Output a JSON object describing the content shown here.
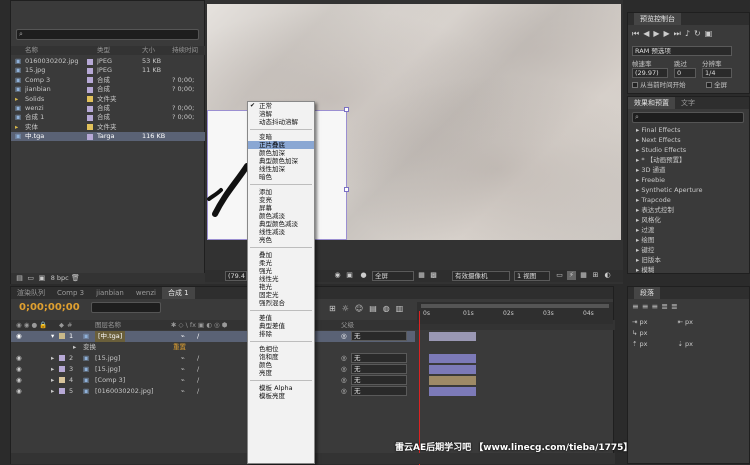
{
  "project": {
    "columns": {
      "name": "名称",
      "type": "类型",
      "size": "大小",
      "duration": "持续时间"
    },
    "items": [
      {
        "name": "0160030202.jpg",
        "color": "#b7a9d6",
        "type": "JPEG",
        "size": "53 KB",
        "duration": ""
      },
      {
        "name": "15.jpg",
        "color": "#b7a9d6",
        "type": "JPEG",
        "size": "11 KB",
        "duration": ""
      },
      {
        "name": "Comp 3",
        "color": "#b7a9d6",
        "type": "合成",
        "size": "",
        "duration": "? 0;00;"
      },
      {
        "name": "jianbian",
        "color": "#b7a9d6",
        "type": "合成",
        "size": "",
        "duration": "? 0;00;"
      },
      {
        "name": "Solids",
        "color": "#e2c15a",
        "type": "文件夹",
        "size": "",
        "duration": ""
      },
      {
        "name": "wenzi",
        "color": "#b7a9d6",
        "type": "合成",
        "size": "",
        "duration": "? 0;00;"
      },
      {
        "name": "合成 1",
        "color": "#b7a9d6",
        "type": "合成",
        "size": "",
        "duration": "? 0;00;"
      },
      {
        "name": "实体",
        "color": "#e2c15a",
        "type": "文件夹",
        "size": "",
        "duration": ""
      },
      {
        "name": "中.tga",
        "color": "#b7a9d6",
        "type": "Targa",
        "size": "116 KB",
        "duration": ""
      }
    ],
    "bpc": "8 bpc"
  },
  "blend_menu": {
    "groups": [
      [
        {
          "label": "正常",
          "checked": true
        },
        {
          "label": "溶解"
        },
        {
          "label": "动态抖动溶解"
        }
      ],
      [
        {
          "label": "变暗"
        },
        {
          "label": "正片叠底",
          "highlight": true
        },
        {
          "label": "颜色加深"
        },
        {
          "label": "典型颜色加深"
        },
        {
          "label": "线性加深"
        },
        {
          "label": "暗色"
        }
      ],
      [
        {
          "label": "添加"
        },
        {
          "label": "变亮"
        },
        {
          "label": "屏幕"
        },
        {
          "label": "颜色减淡"
        },
        {
          "label": "典型颜色减淡"
        },
        {
          "label": "线性减淡"
        },
        {
          "label": "亮色"
        }
      ],
      [
        {
          "label": "叠加"
        },
        {
          "label": "柔光"
        },
        {
          "label": "强光"
        },
        {
          "label": "线性光"
        },
        {
          "label": "艳光"
        },
        {
          "label": "固定光"
        },
        {
          "label": "强烈混合"
        }
      ],
      [
        {
          "label": "差值"
        },
        {
          "label": "典型差值"
        },
        {
          "label": "排除"
        }
      ],
      [
        {
          "label": "色相位"
        },
        {
          "label": "饱和度"
        },
        {
          "label": "颜色"
        },
        {
          "label": "亮度"
        }
      ],
      [
        {
          "label": "模板 Alpha"
        },
        {
          "label": "模板亮度"
        }
      ]
    ]
  },
  "viewer": {
    "zoom": "(79.4",
    "channel": "全屏",
    "camera": "有效摄像机",
    "views": "1 视图"
  },
  "preview": {
    "title": "预览控制台",
    "ram_label": "RAM 预选项",
    "fps_label": "帧速率",
    "skip_label": "跳过",
    "res_label": "分辨率",
    "fps_value": "(29.97)",
    "skip_value": "0",
    "res_value": "1/4",
    "from_current": "从当前时间开始",
    "fullscreen": "全屏"
  },
  "effects": {
    "tab1": "效果和预置",
    "tab2": "文字",
    "items": [
      "Final Effects",
      "Next Effects",
      "Studio Effects",
      "* 【动画预置】",
      "3D 通道",
      "Freebie",
      "Synthetic Aperture",
      "Trapcode",
      "表达式控制",
      "风格化",
      "过渡",
      "绘图",
      "键控",
      "旧版本",
      "模糊"
    ]
  },
  "paragraph": {
    "title": "段落",
    "px": [
      "px",
      "px",
      "px",
      "px",
      "px"
    ]
  },
  "timeline": {
    "tabs": [
      "渲染队列",
      "Comp 3",
      "jianbian",
      "wenzi",
      "合成 1"
    ],
    "active_tab": 4,
    "timecode": "0;00;00;00",
    "col_label": "图层名称",
    "col_parent": "父级",
    "ruler": [
      "0s",
      "01s",
      "02s",
      "03s",
      "04s"
    ],
    "layers": [
      {
        "num": "1",
        "name": "[中.tga]",
        "color": "#c9b98a",
        "parent": "无",
        "selected": true,
        "bar": "#9a98b4"
      },
      {
        "num": "",
        "name": "变换",
        "sub": "重置",
        "parent": "",
        "selected": false,
        "bar": ""
      },
      {
        "num": "2",
        "name": "[15.jpg]",
        "color": "#b7a9d6",
        "parent": "无",
        "selected": false,
        "bar": "#7c7ab8"
      },
      {
        "num": "3",
        "name": "[15.jpg]",
        "color": "#b7a9d6",
        "parent": "无",
        "selected": false,
        "bar": "#7c7ab8"
      },
      {
        "num": "4",
        "name": "[Comp 3]",
        "color": "#d8c49b",
        "parent": "无",
        "selected": false,
        "bar": "#9e8a66"
      },
      {
        "num": "5",
        "name": "[0160030202.jpg]",
        "color": "#b7a9d6",
        "parent": "无",
        "selected": false,
        "bar": "#7c7ab8"
      }
    ]
  },
  "watermark": "雷云AE后期学习吧 【www.linecg.com/tieba/1775】"
}
